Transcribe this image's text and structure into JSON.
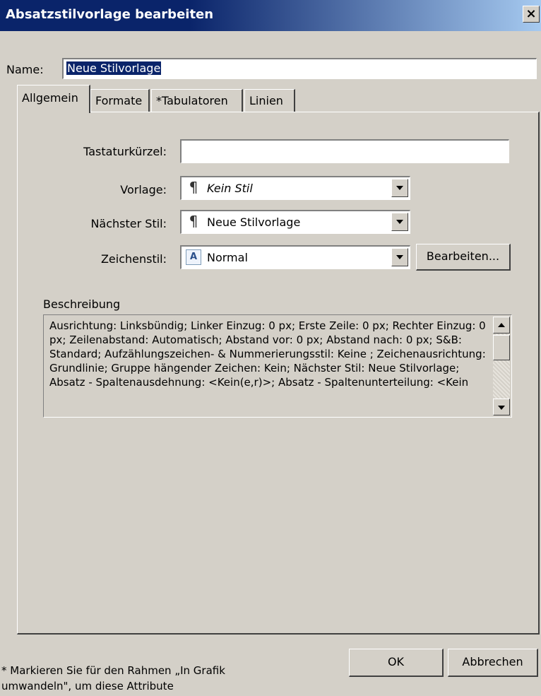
{
  "dialog": {
    "title": "Absatzstilvorlage bearbeiten",
    "close_glyph": "×"
  },
  "name": {
    "label": "Name:",
    "value": "Neue Stilvorlage"
  },
  "tabs": [
    {
      "label": "Allgemein",
      "active": true
    },
    {
      "label": "Formate",
      "active": false
    },
    {
      "label": "*Tabulatoren",
      "active": false
    },
    {
      "label": "Linien",
      "active": false
    }
  ],
  "general": {
    "shortcut": {
      "label": "Tastaturkürzel:",
      "value": ""
    },
    "template": {
      "label": "Vorlage:",
      "value": "Kein Stil",
      "icon": "pilcrow-icon",
      "glyph": "¶"
    },
    "next_style": {
      "label": "Nächster Stil:",
      "value": "Neue Stilvorlage",
      "icon": "pilcrow-icon",
      "glyph": "¶"
    },
    "char_style": {
      "label": "Zeichenstil:",
      "value": "Normal",
      "icon": "character-style-icon",
      "glyph": "A"
    },
    "edit_button": "Bearbeiten...",
    "description": {
      "label": "Beschreibung",
      "text": "Ausrichtung: Linksbündig;  Linker Einzug: 0 px;  Erste Zeile: 0 px;  Rechter Einzug: 0 px;  Zeilenabstand: Automatisch;  Abstand vor: 0 px;  Abstand nach: 0 px;  S&B: Standard;  Aufzählungszeichen- & Nummerierungsstil: Keine ;  Zeichenausrichtung: Grundlinie;  Gruppe hängender Zeichen: Kein;  Nächster Stil: Neue Stilvorlage;  Absatz - Spaltenausdehnung: <Kein(e,r)>;  Absatz - Spaltenunterteilung: <Kein"
    }
  },
  "footer": {
    "note": "* Markieren Sie für den Rahmen „In Grafik umwandeln\", um diese Attribute",
    "ok": "OK",
    "cancel": "Abbrechen"
  }
}
